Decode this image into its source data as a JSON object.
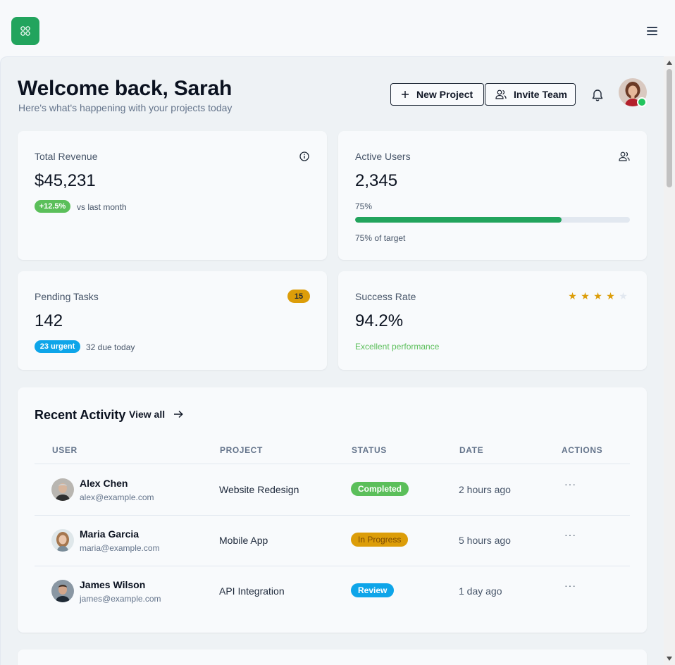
{
  "header": {
    "logo_icon": "grid-logo-icon",
    "menu_icon": "hamburger-icon",
    "title": "Welcome back, Sarah",
    "subtitle": "Here's what's happening with your projects today",
    "new_project_label": "New Project",
    "invite_team_label": "Invite Team",
    "accent_color": "#22a45d"
  },
  "stats": {
    "revenue": {
      "label": "Total Revenue",
      "value": "$45,231",
      "change": "+12.5%",
      "change_text": "vs last month"
    },
    "users": {
      "label": "Active Users",
      "value": "2,345",
      "progress_label": "75%",
      "progress_fraction": 0.75,
      "caption": "75% of target"
    },
    "tasks": {
      "label": "Pending Tasks",
      "count": "15",
      "value": "142",
      "urgent": "23 urgent",
      "due": "32 due today"
    },
    "success": {
      "label": "Success Rate",
      "value": "94.2%",
      "rating": 4,
      "rating_max": 5,
      "note": "Excellent performance"
    }
  },
  "activity": {
    "title": "Recent Activity",
    "view_all": "View all",
    "columns": [
      "USER",
      "PROJECT",
      "STATUS",
      "DATE",
      "ACTIONS"
    ],
    "rows": [
      {
        "name": "Alex Chen",
        "email": "alex@example.com",
        "project": "Website Redesign",
        "status": "Completed",
        "date": "2 hours ago",
        "actions": "···"
      },
      {
        "name": "Maria Garcia",
        "email": "maria@example.com",
        "project": "Mobile App",
        "status": "In Progress",
        "date": "5 hours ago",
        "actions": "···"
      },
      {
        "name": "James Wilson",
        "email": "james@example.com",
        "project": "API Integration",
        "status": "Review",
        "date": "1 day ago",
        "actions": "···"
      }
    ],
    "status_colors": {
      "Completed": "#5bbf5a",
      "In Progress": "#dc9d09",
      "Review": "#0ea5e9"
    }
  }
}
